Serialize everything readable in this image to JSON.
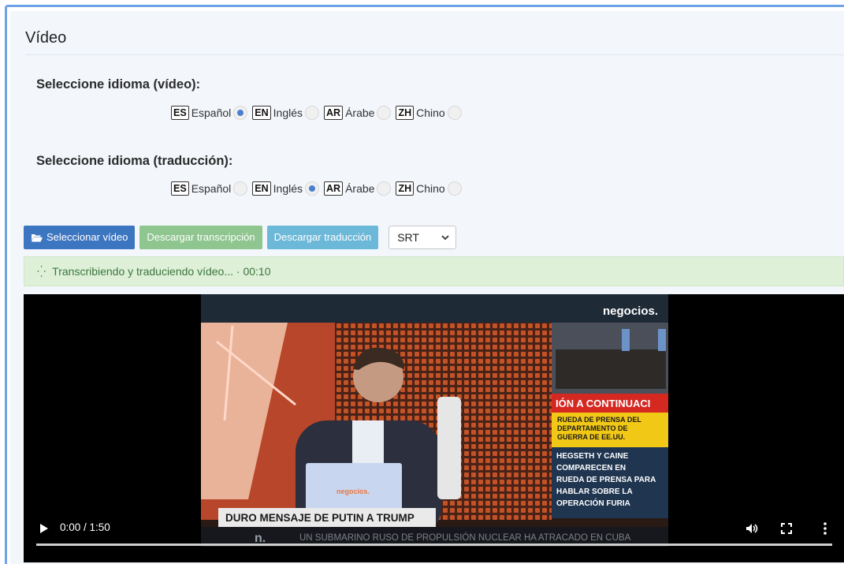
{
  "panel": {
    "title": "Vídeo"
  },
  "video_lang": {
    "label": "Seleccione idioma (vídeo):",
    "options": [
      {
        "code": "ES",
        "name": "Español",
        "checked": true
      },
      {
        "code": "EN",
        "name": "Inglés",
        "checked": false
      },
      {
        "code": "AR",
        "name": "Árabe",
        "checked": false
      },
      {
        "code": "ZH",
        "name": "Chino",
        "checked": false
      }
    ]
  },
  "translation_lang": {
    "label": "Seleccione idioma (traducción):",
    "options": [
      {
        "code": "ES",
        "name": "Español",
        "checked": false
      },
      {
        "code": "EN",
        "name": "Inglés",
        "checked": true
      },
      {
        "code": "AR",
        "name": "Árabe",
        "checked": false
      },
      {
        "code": "ZH",
        "name": "Chino",
        "checked": false
      }
    ]
  },
  "toolbar": {
    "select_video": "Seleccionar vídeo",
    "download_transcription": "Descargar transcripción",
    "download_translation": "Descargar traducción",
    "format_value": "SRT"
  },
  "status": {
    "text": "Transcribiendo y traduciendo vídeo... · 00:10"
  },
  "video": {
    "time": "0:00 / 1:50",
    "progress": 0,
    "overlay": {
      "channel_logo": "negocios.",
      "laptop_logo": "negocios.",
      "side_banner": "IÓN A CONTINUACI",
      "side_yellow": "RUEDA DE PRENSA DEL DEPARTAMENTO DE GUERRA DE EE.UU.",
      "side_blue": "HEGSETH Y CAINE COMPARECEN EN RUEDA DE PRENSA PARA HABLAR SOBRE LA OPERACIÓN FURIA",
      "headline": "DURO MENSAJE DE PUTIN A TRUMP",
      "ticker_logo": "n.",
      "ticker": "UN SUBMARINO RUSO DE PROPULSIÓN NUCLEAR HA ATRACADO EN CUBA"
    }
  }
}
